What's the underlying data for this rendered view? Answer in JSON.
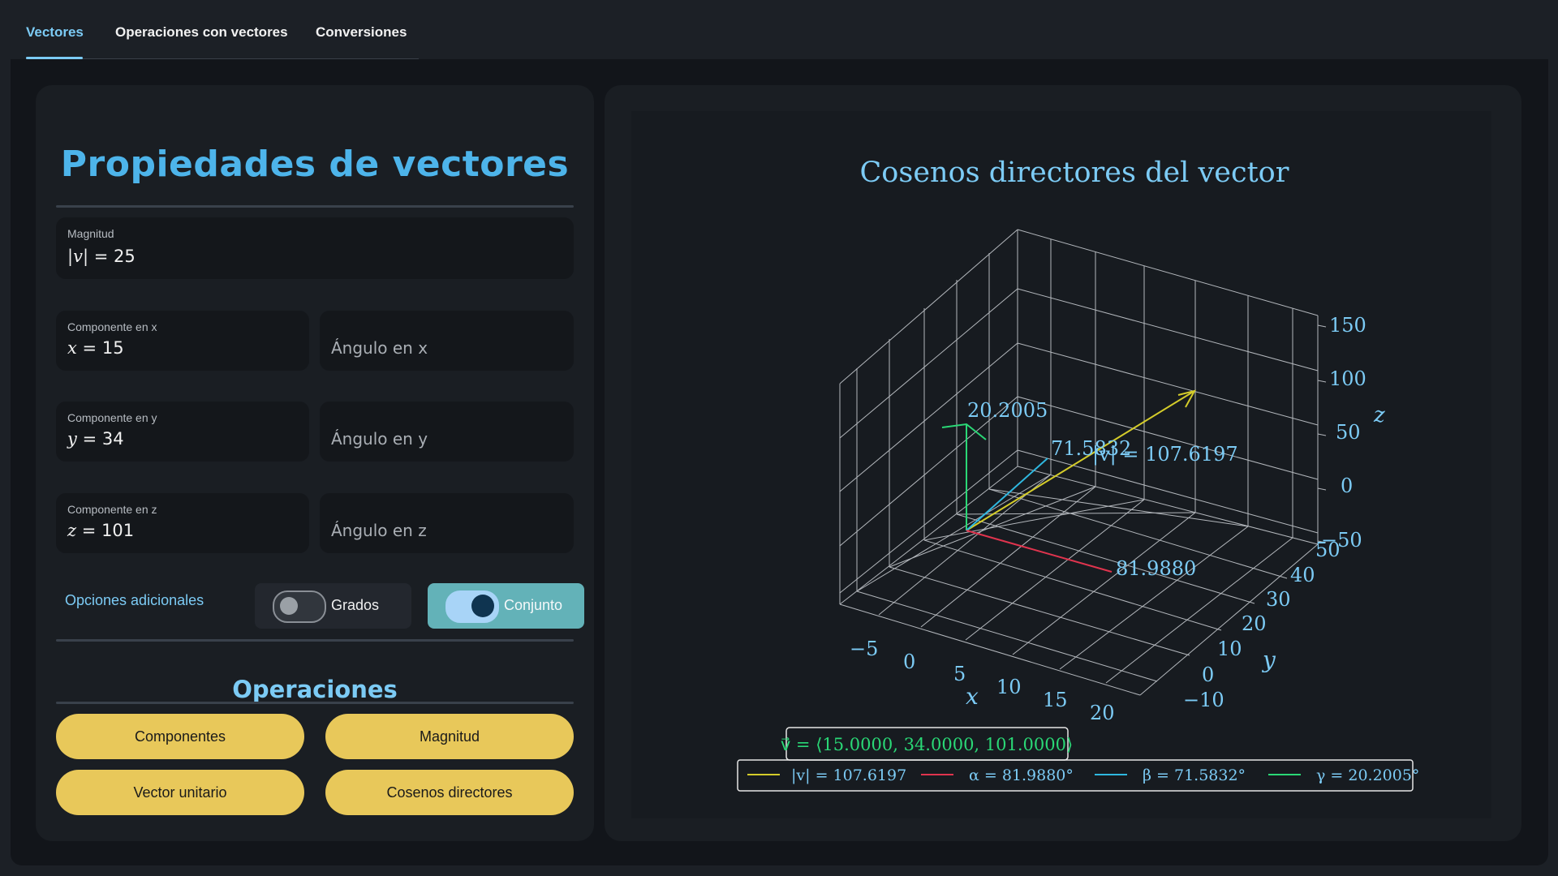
{
  "tabs": [
    {
      "label": "Vectores",
      "active": true
    },
    {
      "label": "Operaciones con vectores",
      "active": false
    },
    {
      "label": "Conversiones",
      "active": false
    }
  ],
  "left": {
    "title": "Propiedades de vectores",
    "magnitude": {
      "label": "Magnitud",
      "var": "|v|",
      "eq": "=",
      "value": "25"
    },
    "x": {
      "label": "Componente en x",
      "var": "x",
      "eq": "=",
      "value": "15",
      "angle_placeholder": "Ángulo en x"
    },
    "y": {
      "label": "Componente en y",
      "var": "y",
      "eq": "=",
      "value": "34",
      "angle_placeholder": "Ángulo en y"
    },
    "z": {
      "label": "Componente en z",
      "var": "z",
      "eq": "=",
      "value": "101",
      "angle_placeholder": "Ángulo en z"
    },
    "options_label": "Opciones adicionales",
    "toggle_degrees": {
      "label": "Grados",
      "on": false
    },
    "toggle_set": {
      "label": "Conjunto",
      "on": true
    },
    "operations_title": "Operaciones",
    "buttons": [
      "Componentes",
      "Magnitud",
      "Vector unitario",
      "Cosenos directores"
    ]
  },
  "colors": {
    "accent": "#4db4ea",
    "button": "#e8c85a",
    "toggle_on_bg": "#63b2b8",
    "magnitude_line": "#d4cc2a",
    "alpha_line": "#e0344e",
    "beta_line": "#2fb8e0",
    "gamma_line": "#2ad876"
  },
  "plot": {
    "title": "Cosenos directores del vector",
    "x_label": "x",
    "y_label": "y",
    "z_label": "z",
    "x_ticks": [
      "−5",
      "0",
      "5",
      "10",
      "15",
      "20"
    ],
    "y_ticks": [
      "−10",
      "0",
      "10",
      "20",
      "30",
      "40",
      "50"
    ],
    "z_ticks": [
      "−50",
      "0",
      "50",
      "100",
      "150"
    ],
    "ann_gamma": "20.2005",
    "ann_beta": "71.5832",
    "ann_mag": "|v| = 107.6197",
    "ann_alpha": "81.9880",
    "vector_box": "v⃗ = ⟨15.0000, 34.0000, 101.0000⟩",
    "legend": [
      "|v| = 107.6197",
      "α = 81.9880°",
      "β = 71.5832°",
      "γ = 20.2005°"
    ]
  }
}
